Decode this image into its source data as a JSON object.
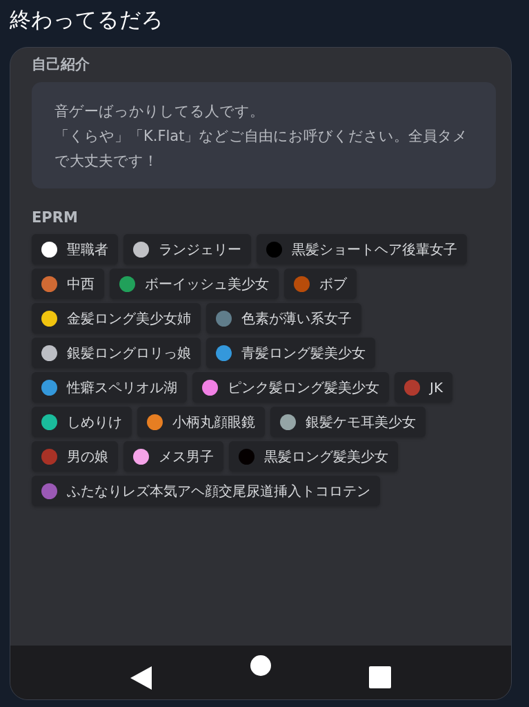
{
  "header": {
    "title": "終わってるだろ"
  },
  "about": {
    "label": "自己紹介",
    "lines": [
      "音ゲーばっかりしてる人です。",
      "「くらや」「K.Flat」などご自由にお呼びください。全員タメで大丈夫です！"
    ]
  },
  "roles": {
    "label": "EPRM",
    "items": [
      {
        "name": "聖職者",
        "color": "#ffffff"
      },
      {
        "name": "ランジェリー",
        "color": "#c0c1c5"
      },
      {
        "name": "黒髪ショートヘア後輩女子",
        "color": "#000000"
      },
      {
        "name": "中西",
        "color": "#d06a34"
      },
      {
        "name": "ボーイッシュ美少女",
        "color": "#21a05a"
      },
      {
        "name": "ボブ",
        "color": "#b84c0a"
      },
      {
        "name": "金髪ロング美少女姉",
        "color": "#f1c40f"
      },
      {
        "name": "色素が薄い系女子",
        "color": "#607d8b"
      },
      {
        "name": "銀髪ロングロリっ娘",
        "color": "#bcbec4"
      },
      {
        "name": "青髪ロング髪美少女",
        "color": "#3498db"
      },
      {
        "name": "性癖スペリオル湖",
        "color": "#3498db"
      },
      {
        "name": "ピンク髪ロング髪美少女",
        "color": "#f080e4"
      },
      {
        "name": "JK",
        "color": "#b03a2e"
      },
      {
        "name": "しめりけ",
        "color": "#1abc9c"
      },
      {
        "name": "小柄丸顔眼鏡",
        "color": "#e67e22"
      },
      {
        "name": "銀髪ケモ耳美少女",
        "color": "#95a5a6"
      },
      {
        "name": "男の娘",
        "color": "#a93226"
      },
      {
        "name": "メス男子",
        "color": "#f5a3e8"
      },
      {
        "name": "黒髪ロング髪美少女",
        "color": "#050000"
      },
      {
        "name": "ふたなりレズ本気アヘ顔交尾尿道挿入トコロテン",
        "color": "#9b59b6"
      }
    ]
  }
}
